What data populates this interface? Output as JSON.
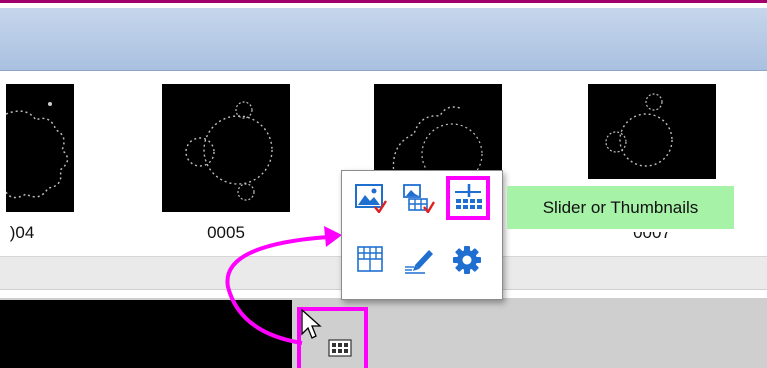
{
  "thumbnails": [
    {
      "label": ")04"
    },
    {
      "label": "0005"
    },
    {
      "label": ""
    },
    {
      "label": "0007"
    }
  ],
  "popup": {
    "buttons": [
      {
        "icon": "image-settings-icon"
      },
      {
        "icon": "image-table-settings-icon"
      },
      {
        "icon": "slider-thumbnails-icon"
      },
      {
        "icon": "grid-table-icon"
      },
      {
        "icon": "edit-pen-icon"
      },
      {
        "icon": "gear-icon"
      }
    ]
  },
  "tooltip": {
    "text": "Slider or Thumbnails"
  },
  "colors": {
    "highlight": "#ff00ff",
    "tooltip_bg": "#a6f2a6",
    "icon_blue": "#1f6fd1",
    "title_band": "#b7cbe6"
  }
}
